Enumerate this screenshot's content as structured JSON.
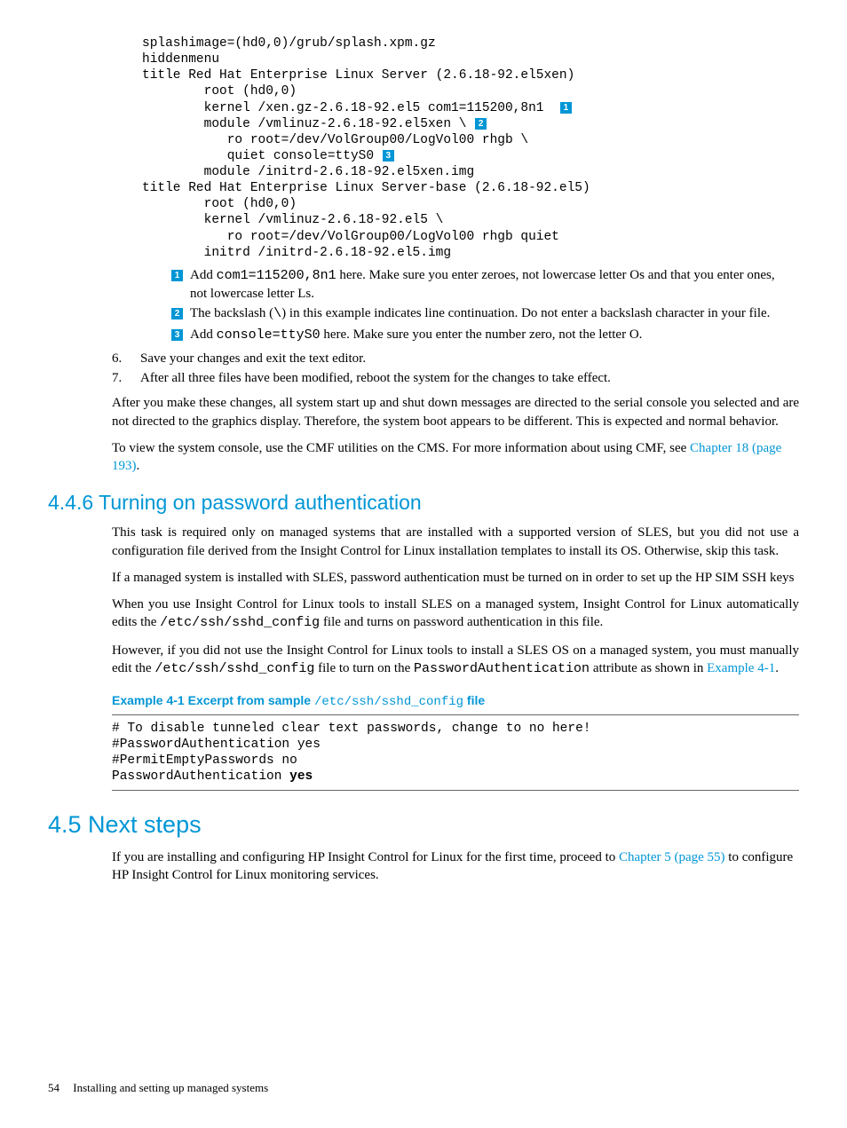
{
  "code": {
    "l1": "splashimage=(hd0,0)/grub/splash.xpm.gz",
    "l2": "hiddenmenu",
    "l3": "title Red Hat Enterprise Linux Server (2.6.18-92.el5xen)",
    "l4": "        root (hd0,0)",
    "l5a": "        kernel /xen.gz-2.6.18-92.el5 com1=115200,8n1  ",
    "l6a": "        module /vmlinuz-2.6.18-92.el5xen \\ ",
    "l7": "           ro root=/dev/VolGroup00/LogVol00 rhgb \\",
    "l8a": "           quiet console=ttyS0 ",
    "l9": "        module /initrd-2.6.18-92.el5xen.img",
    "l10": "title Red Hat Enterprise Linux Server-base (2.6.18-92.el5)",
    "l11": "        root (hd0,0)",
    "l12": "        kernel /vmlinuz-2.6.18-92.el5 \\",
    "l13": "           ro root=/dev/VolGroup00/LogVol00 rhgb quiet",
    "l14": "        initrd /initrd-2.6.18-92.el5.img"
  },
  "callouts": {
    "n1": "1",
    "n2": "2",
    "n3": "3"
  },
  "annot": {
    "i1a": "Add ",
    "i1code": "com1=115200,8n1",
    "i1b": " here. Make sure you enter zeroes, not lowercase letter Os and that you enter ones, not lowercase letter Ls.",
    "i2a": "The backslash (",
    "i2code": "\\",
    "i2b": ") in this example indicates line continuation. Do not enter a backslash character in your file.",
    "i3a": "Add ",
    "i3code": "console=ttyS0",
    "i3b": " here. Make sure you enter the number zero, not the letter O."
  },
  "steps": {
    "s6num": "6.",
    "s6": "Save your changes and exit the text editor.",
    "s7num": "7.",
    "s7": "After all three files have been modified, reboot the system for the changes to take effect."
  },
  "para": {
    "p1": "After you make these changes, all system start up and shut down messages are directed to the serial console you selected and are not directed to the graphics display. Therefore, the system boot appears to be different. This is expected and normal behavior.",
    "p2a": "To view the system console, use the CMF utilities on the CMS. For more information about using CMF, see ",
    "p2link": "Chapter 18 (page 193)",
    "p2b": "."
  },
  "sec46": {
    "title": "4.4.6 Turning on password authentication",
    "p1": "This task is required only on managed systems that are installed with a supported version of SLES, but you did not use a configuration file derived from the Insight Control for Linux installation templates to install its OS. Otherwise, skip this task.",
    "p2": "If a managed system is installed with SLES, password authentication must be turned on in order to set up the HP SIM SSH keys",
    "p3a": "When you use Insight Control for Linux tools to install SLES on a managed system, Insight Control for Linux automatically edits the ",
    "p3code": "/etc/ssh/sshd_config",
    "p3b": " file and turns on password authentication in this file.",
    "p4a": "However, if you did not use the Insight Control for Linux tools to install a SLES OS on a managed system, you must manually edit the ",
    "p4code1": "/etc/ssh/sshd_config",
    "p4b": " file to turn on the ",
    "p4code2": "PasswordAuthentication",
    "p4c": " attribute as shown in ",
    "p4link": "Example 4-1",
    "p4d": "."
  },
  "example": {
    "title_a": "Example 4-1 Excerpt from sample ",
    "title_code": "/etc/ssh/sshd_config",
    "title_b": " file",
    "l1": "# To disable tunneled clear text passwords, change to no here!",
    "l2": "#PasswordAuthentication yes",
    "l3": "#PermitEmptyPasswords no",
    "l4a": "PasswordAuthentication ",
    "l4b": "yes"
  },
  "sec45": {
    "title": "4.5 Next steps",
    "p1a": "If you are installing and configuring HP Insight Control for Linux for the first time, proceed to ",
    "p1link": "Chapter 5 (page 55)",
    "p1b": " to configure HP Insight Control for Linux monitoring services."
  },
  "footer": {
    "pagenum": "54",
    "chapter": "Installing and setting up managed systems"
  }
}
